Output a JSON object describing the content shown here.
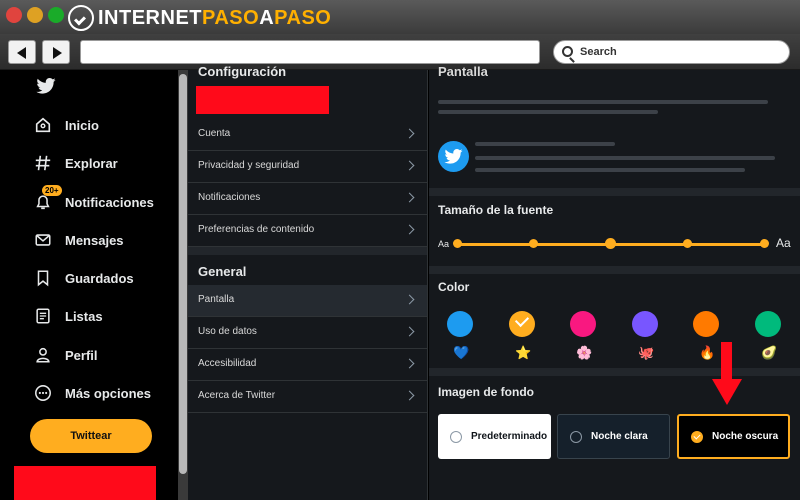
{
  "browser": {
    "brand": {
      "part1": "INTERNET",
      "part2": "PASO",
      "part3": "A",
      "part4": "PASO"
    },
    "search_placeholder": "Search"
  },
  "leftnav": {
    "items": [
      {
        "label": "Inicio",
        "icon": "home-icon"
      },
      {
        "label": "Explorar",
        "icon": "hashtag-icon"
      },
      {
        "label": "Notificaciones",
        "icon": "bell-icon",
        "badge": "20+"
      },
      {
        "label": "Mensajes",
        "icon": "mail-icon"
      },
      {
        "label": "Guardados",
        "icon": "bookmark-icon"
      },
      {
        "label": "Listas",
        "icon": "list-icon"
      },
      {
        "label": "Perfil",
        "icon": "profile-icon"
      },
      {
        "label": "Más opciones",
        "icon": "more-icon"
      }
    ],
    "tweet_button": "Twittear"
  },
  "settings": {
    "title": "Configuración",
    "account_items": [
      "Cuenta",
      "Privacidad y seguridad",
      "Notificaciones",
      "Preferencias de contenido"
    ],
    "general_title": "General",
    "general_items": [
      "Pantalla",
      "Uso de datos",
      "Accesibilidad",
      "Acerca de Twitter"
    ],
    "active_item": "Pantalla"
  },
  "display": {
    "title": "Pantalla",
    "font_size_title": "Tamaño de la fuente",
    "font_small_label": "Aa",
    "font_large_label": "Aa",
    "font_levels": 5,
    "font_selected_index": 2,
    "color_title": "Color",
    "colors": [
      {
        "hex": "#1d9bf0",
        "emoji": "💙"
      },
      {
        "hex": "#ffad1f",
        "emoji": "⭐",
        "selected": true
      },
      {
        "hex": "#f91880",
        "emoji": "🌸"
      },
      {
        "hex": "#7856ff",
        "emoji": "🐙"
      },
      {
        "hex": "#ff7a00",
        "emoji": "🔥"
      },
      {
        "hex": "#00ba7c",
        "emoji": "🥑"
      }
    ],
    "background_title": "Imagen de fondo",
    "backgrounds": [
      {
        "label": "Predeterminado"
      },
      {
        "label": "Noche clara"
      },
      {
        "label": "Noche oscura",
        "selected": true
      }
    ]
  },
  "colors": {
    "accent": "#ffad1f",
    "redaction": "#ff0a1a",
    "arrow": "#ff0a1a"
  }
}
